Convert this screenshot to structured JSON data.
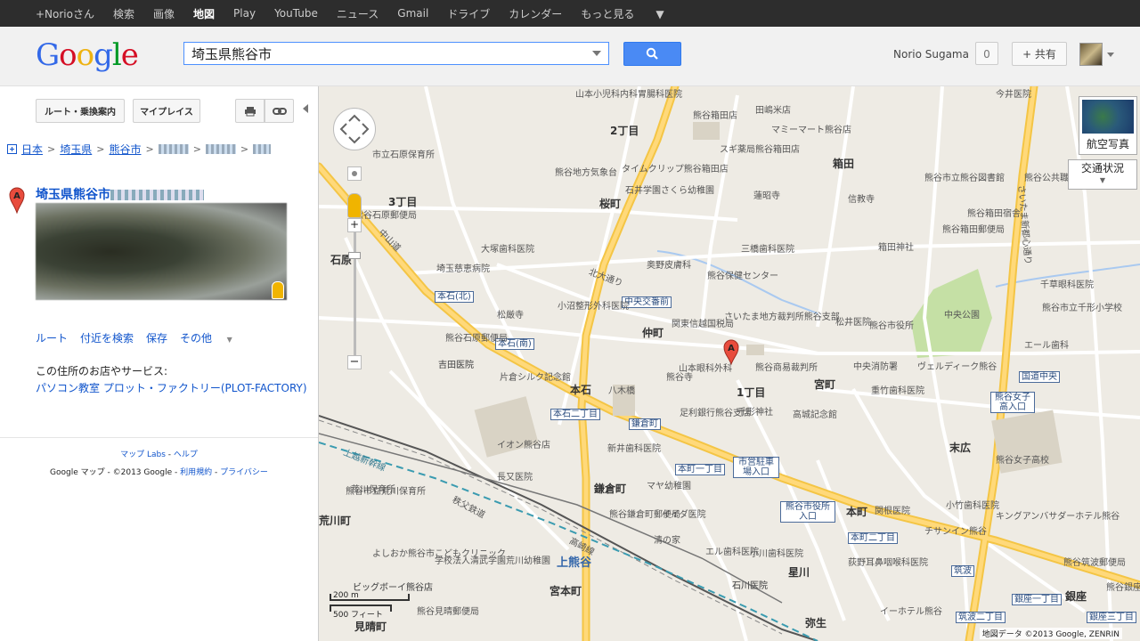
{
  "topbar": {
    "items": [
      "+Norioさん",
      "検索",
      "画像",
      "地図",
      "Play",
      "YouTube",
      "ニュース",
      "Gmail",
      "ドライブ",
      "カレンダー",
      "もっと見る"
    ],
    "active": "地図"
  },
  "header": {
    "logo": "Google",
    "logo_colors": [
      "#3369e8",
      "#d50f25",
      "#eeb211",
      "#3369e8",
      "#009925",
      "#d50f25"
    ],
    "search_value": "埼玉県熊谷市",
    "user_name": "Norio Sugama",
    "notifications": "0",
    "share_label": "+ 共有"
  },
  "leftpanel": {
    "route_button": "ルート・乗換案内",
    "myplaces_button": "マイプレイス",
    "breadcrumb": [
      "日本",
      "埼玉県",
      "熊谷市"
    ],
    "result_marker": "A",
    "result_title": "埼玉県熊谷市",
    "actions": [
      "ルート",
      "付近を検索",
      "保存",
      "その他"
    ],
    "business_label": "この住所のお店やサービス:",
    "business_link": "パソコン教室 プロット・ファクトリー(PLOT-FACTORY)",
    "footer_links": [
      "マップ Labs",
      "ヘルプ"
    ],
    "footer_copy": "Google マップ - ©2013 Google -",
    "footer_terms": "利用規約",
    "footer_privacy": "プライバシー"
  },
  "map": {
    "aerial_label": "航空写真",
    "traffic_label": "交通状況",
    "scale_metric": "200 m",
    "scale_imperial": "500 フィート",
    "attribution": "地図データ ©2013 Google, ZENRIN",
    "marker": "A",
    "districts": [
      "2丁目",
      "3丁目",
      "箱田",
      "桜町",
      "石原",
      "仲町",
      "1丁目",
      "本石",
      "宮町",
      "末広",
      "鎌倉町",
      "本町",
      "星川",
      "宮本町",
      "銀座",
      "弥生",
      "見晴町",
      "荒川町"
    ],
    "stations": [
      "上熊谷"
    ],
    "road_boxes": [
      "本石(北)",
      "本石(南)",
      "中央交番前",
      "本石二丁目",
      "鎌倉町",
      "本町一丁目",
      "市営駐車場入口",
      "熊谷市役所入口",
      "本町二丁目",
      "熊谷女子高入口",
      "筑波",
      "銀座一丁目",
      "筑波二丁目",
      "銀座三丁目",
      "国道中央"
    ],
    "rail_labels": [
      "上越新幹線",
      "秩父鉄道",
      "高崎線"
    ],
    "road_labels": [
      "中山道",
      "北大通り",
      "さいたま新都心通り"
    ],
    "pois": [
      "市立石原保育所",
      "熊谷地方気象台",
      "タイムクリップ熊谷箱田店",
      "熊谷市立熊谷図書館",
      "埼玉慈恵病院",
      "大塚歯科医院",
      "奥野皮膚科",
      "熊谷保健センター",
      "さいたま地方裁判所熊谷支部",
      "松井医院",
      "熊谷市役所",
      "中央公園",
      "ヴェルディーク熊谷",
      "山本眼科外科",
      "千形神社",
      "足利銀行熊谷支店",
      "イオン熊谷店",
      "熊谷商易裁判所",
      "熊谷女子高校",
      "八木橋",
      "高城記念館",
      "関根医院",
      "小竹歯科医院",
      "エル歯科医院",
      "熊谷筑波郵便局",
      "キングアンバサダーホテル熊谷",
      "荒川保育所",
      "吉田医院",
      "片倉シルク記念館",
      "熊谷市立荒川保育所",
      "熊谷見晴郵便局",
      "ビッグボーイ熊谷店",
      "学校法人清武学園荒川幼稚園",
      "熊谷鎌倉町郵便局",
      "イイダ医院",
      "清の家",
      "小川歯科医院",
      "荻野耳鼻咽喉科医院",
      "石川医院",
      "チサンイン熊谷",
      "イーホテル熊谷",
      "熊谷銀座郵便局",
      "熊谷公共職業安定所",
      "熊谷箱田郵便局",
      "千草眼科医院",
      "熊谷市立千形小学校",
      "エール歯科",
      "重竹歯科医院",
      "中央消防署",
      "新井歯科医院",
      "長又医院",
      "マヤ幼稚園",
      "関東信越国税局",
      "熊谷石原郵便局",
      "今井医院",
      "山本小児科内科胃腸科医院",
      "熊谷箱田店",
      "田嶋米店",
      "マミーマート熊谷店",
      "スギ薬局熊谷箱田店",
      "蓮昭寺",
      "信教寺",
      "箱田神社",
      "熊谷箱田宿舎",
      "石井学園さくら幼稚園",
      "三橋歯科医院",
      "松厳寺",
      "小沼整形外科医院",
      "熊谷石原郵便局",
      "吉田医院",
      "熊谷寺",
      "石川医院",
      "よしおか熊谷市こどもクリニック",
      "ビッグボーイ熊谷店"
    ]
  }
}
